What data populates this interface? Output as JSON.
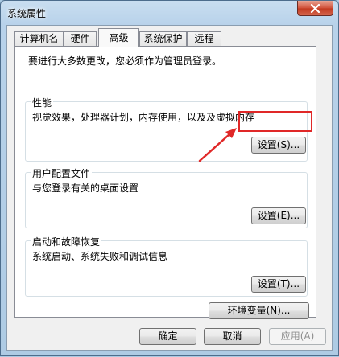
{
  "window": {
    "title": "系统属性"
  },
  "tabs": [
    {
      "label": "计算机名"
    },
    {
      "label": "硬件"
    },
    {
      "label": "高级"
    },
    {
      "label": "系统保护"
    },
    {
      "label": "远程"
    }
  ],
  "active_tab": "高级",
  "panel": {
    "admin_note": "要进行大多数更改，您必须作为管理员登录。",
    "performance": {
      "label": "性能",
      "description": "视觉效果，处理器计划，内存使用，以及及虚拟内存",
      "button": "设置(S)..."
    },
    "user_profiles": {
      "label": "用户配置文件",
      "description": "与您登录有关的桌面设置",
      "button": "设置(E)..."
    },
    "startup": {
      "label": "启动和故障恢复",
      "description": "系统启动、系统失败和调试信息",
      "button": "设置(T)..."
    },
    "env_button": "环境变量(N)..."
  },
  "footer": {
    "ok": "确定",
    "cancel": "取消",
    "apply": "应用(A)"
  },
  "colors": {
    "annotation": "#e02828",
    "title_bar": "#b8d2ea"
  }
}
